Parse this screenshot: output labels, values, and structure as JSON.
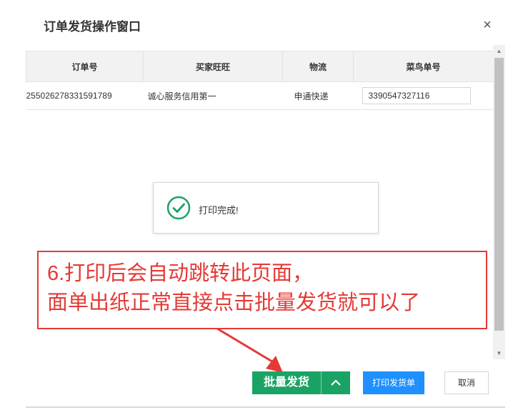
{
  "dialog": {
    "title": "订单发货操作窗口",
    "close_label": "×"
  },
  "table": {
    "headers": [
      "订单号",
      "买家旺旺",
      "物流",
      "菜鸟单号"
    ],
    "rows": [
      {
        "order_no": "255026278331591789",
        "buyer": "诚心服务信用第一",
        "logistics": "申通快递",
        "tracking": "3390547327116"
      }
    ]
  },
  "toast": {
    "icon": "check-circle-icon",
    "message": "打印完成!"
  },
  "annotation": {
    "line1": "6.打印后会自动跳转此页面，",
    "line2": "面单出纸正常直接点击批量发货就可以了",
    "color": "#e53935"
  },
  "footer": {
    "batch_ship_label": "批量发货",
    "print_label": "打印发货单",
    "cancel_label": "取消"
  },
  "colors": {
    "primary_green": "#1aa364",
    "primary_blue": "#1e90ff",
    "success_icon": "#1aa364"
  }
}
